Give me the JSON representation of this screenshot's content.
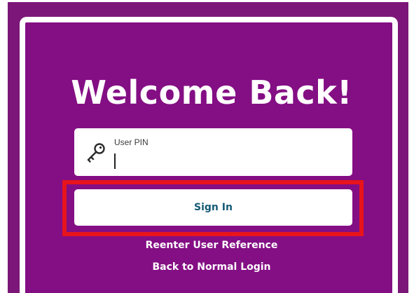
{
  "login": {
    "heading": "Welcome Back!",
    "pin_field": {
      "label": "User PIN",
      "value": "",
      "icon": "key-icon"
    },
    "sign_in_label": "Sign In",
    "links": {
      "reenter_user_reference": "Reenter User Reference",
      "back_to_normal_login": "Back to Normal Login"
    }
  },
  "colors": {
    "background_purple": "#7c1779",
    "card_purple": "#840e84",
    "button_text": "#165b75",
    "highlight_red": "#e8141c"
  }
}
